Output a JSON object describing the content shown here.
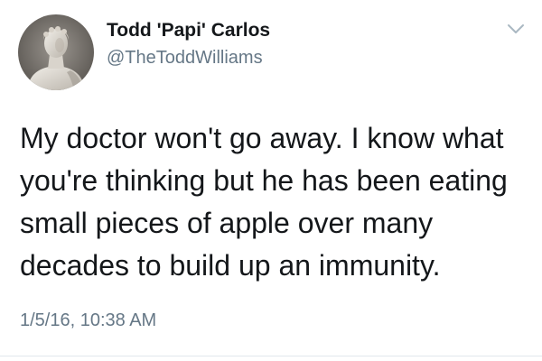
{
  "tweet": {
    "author": {
      "display_name": "Todd 'Papi' Carlos",
      "username": "@TheToddWilliams",
      "avatar_icon": "statue-avatar-icon"
    },
    "menu_icon": "chevron-down-icon",
    "text_lines": [
      "My doctor won't go away. I know what",
      "you're thinking but he has been eating",
      "small pieces of apple over many",
      "decades to build up an immunity."
    ],
    "timestamp": "1/5/16, 10:38 AM"
  },
  "colors": {
    "text_primary": "#14171a",
    "text_secondary": "#657786",
    "divider": "#e1e8ed",
    "chevron": "#aab8c2"
  }
}
